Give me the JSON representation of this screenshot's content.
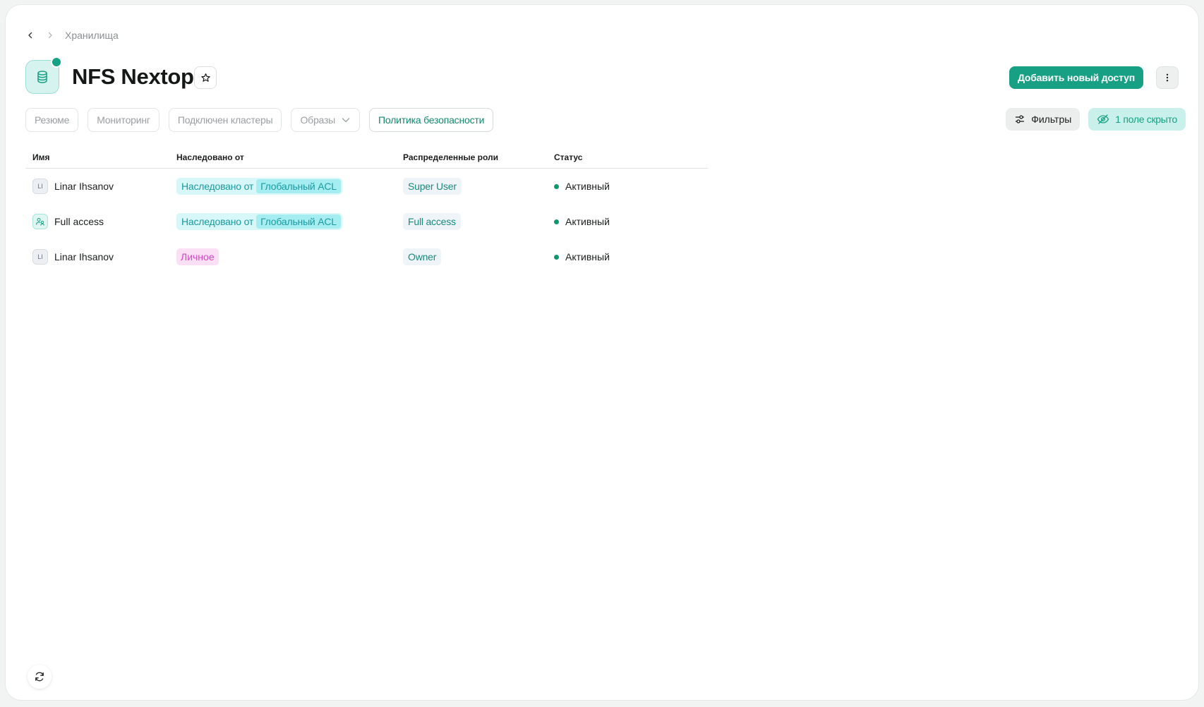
{
  "breadcrumb": {
    "current": "Хранилища"
  },
  "header": {
    "title": "NFS Nextop",
    "primary_action": "Добавить новый доступ"
  },
  "tabs": [
    {
      "label": "Резюме",
      "active": false
    },
    {
      "label": "Мониторинг",
      "active": false
    },
    {
      "label": "Подключен кластеры",
      "active": false
    },
    {
      "label": "Образы",
      "active": false,
      "dropdown": true
    },
    {
      "label": "Политика безопасности",
      "active": true
    }
  ],
  "toolbar": {
    "filters_label": "Фильтры",
    "hidden_fields_label": "1 поле скрыто"
  },
  "table": {
    "columns": [
      "Имя",
      "Наследовано от",
      "Распределенные роли",
      "Статус"
    ],
    "rows": [
      {
        "avatar": "LI",
        "avatar_type": "user",
        "name": "Linar Ihsanov",
        "inherit_prefix": "Наследовано от",
        "inherit_source": "Глобальный ACL",
        "role": "Super User",
        "status": "Активный"
      },
      {
        "avatar": "",
        "avatar_type": "group",
        "name": "Full access",
        "inherit_prefix": "Наследовано от",
        "inherit_source": "Глобальный ACL",
        "role": "Full access",
        "status": "Активный"
      },
      {
        "avatar": "LI",
        "avatar_type": "user",
        "name": "Linar Ihsanov",
        "personal": "Личное",
        "role": "Owner",
        "status": "Активный"
      }
    ]
  },
  "colors": {
    "accent": "#17a083",
    "status_active": "#11966f",
    "inherit_chip": "#d8f7f8",
    "personal_chip": "#fbe0f5"
  },
  "icons": [
    "chevron-left-icon",
    "chevron-right-icon",
    "database-icon",
    "star-icon",
    "more-vertical-icon",
    "chevron-down-icon",
    "sliders-icon",
    "eye-off-icon",
    "users-icon",
    "refresh-icon"
  ]
}
